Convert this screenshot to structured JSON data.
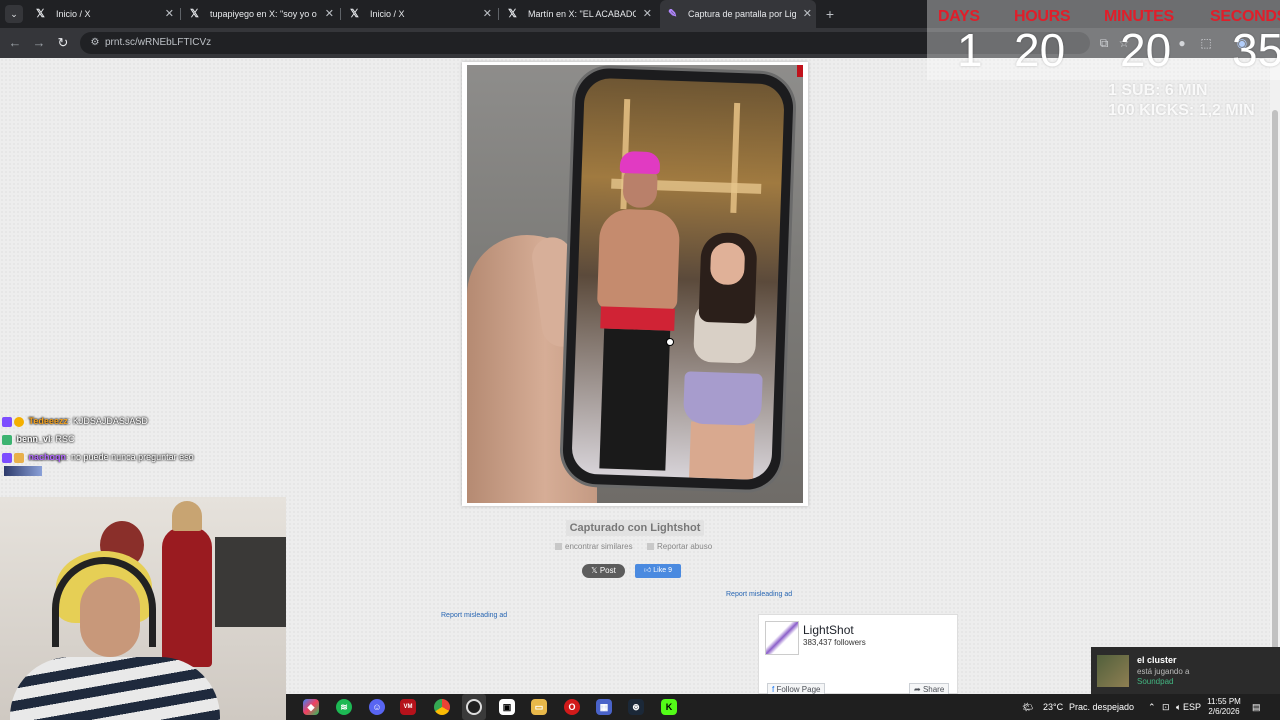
{
  "browser": {
    "tabs": [
      {
        "title": "Inicio / X",
        "icon": "x-logo-icon",
        "active": false
      },
      {
        "title": "tupapiyego en X: \"soy yo o teñí",
        "icon": "x-logo-icon",
        "active": false
      },
      {
        "title": "Inicio / X",
        "icon": "x-logo-icon",
        "active": false
      },
      {
        "title": "Martín en X: \"EL ACABADO VE",
        "icon": "x-logo-icon",
        "active": false
      },
      {
        "title": "Captura de pantalla por Lightsh",
        "icon": "lightshot-feather-icon",
        "active": true
      }
    ],
    "url": "prnt.sc/wRNEbLFTICVz"
  },
  "page": {
    "caption": "Capturado con Lightshot",
    "find_similar": "encontrar similares",
    "report_abuse": "Reportar abuso",
    "x_post_label": "Post",
    "fb_like_label": "Like 9",
    "report_ad_right": "Report misleading ad",
    "report_ad_left": "Report misleading ad",
    "fb_widget": {
      "page_name": "LightShot",
      "followers": "383,437 followers",
      "follow_label": "Follow Page",
      "share_label": "Share"
    }
  },
  "overlay": {
    "timer": {
      "labels": [
        "DAYS",
        "HOURS",
        "MINUTES",
        "SECONDS"
      ],
      "values": [
        "1",
        "20",
        "20",
        "35"
      ],
      "label_color": "#e01e2a"
    },
    "rules": [
      "1 SUB: 6 MIN",
      "100 KICKS: 1,2 MIN"
    ],
    "chat": [
      {
        "user": "Tedeeezz",
        "message": "KJDSAJDASJASD",
        "user_color": "#f0a020"
      },
      {
        "user": "benn_vl",
        "message": "RSC",
        "user_color": "#ffffff"
      },
      {
        "user": "nachoqn",
        "message": "no puede nunca preguntar eso",
        "user_color": "#b469ff"
      }
    ],
    "notification": {
      "name": "el cluster",
      "status": "está jugando a",
      "app": "Soundpad"
    }
  },
  "taskbar": {
    "weather": "23°C",
    "weather_desc": "Prac. despejado",
    "language": "ESP",
    "time": "11:55 PM",
    "date": "2/6/2026"
  }
}
